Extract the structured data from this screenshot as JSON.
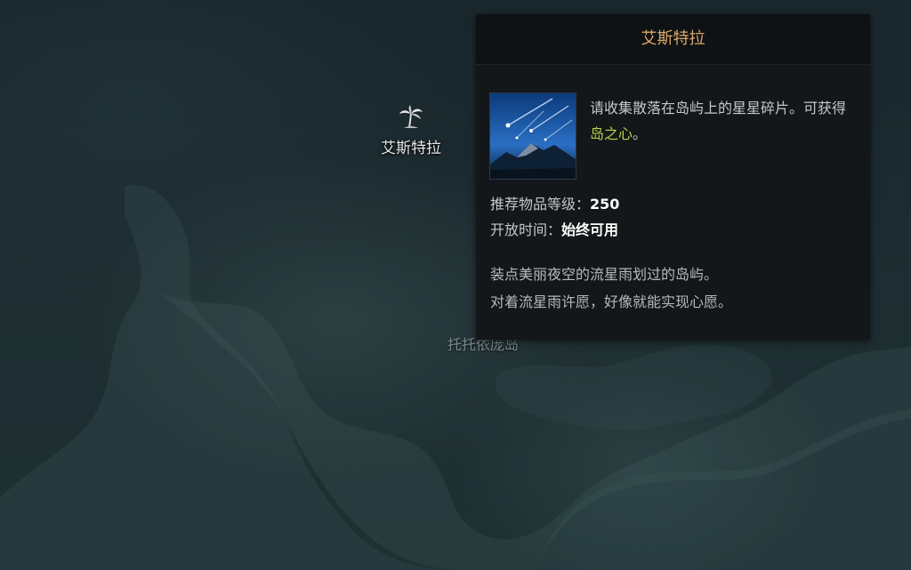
{
  "map": {
    "marker_label": "艾斯特拉",
    "marker_icon": "palm-tree-icon",
    "faded_label": "托托依庞岛"
  },
  "tooltip": {
    "title": "艾斯特拉",
    "item_icon": "meteor-shower-icon",
    "description_prefix": "请收集散落在岛屿上的星星碎片。可获得",
    "description_highlight": "岛之心",
    "description_suffix": "。",
    "recommended_label": "推荐物品等级：",
    "recommended_value": "250",
    "open_time_label": "开放时间：",
    "open_time_value": "始终可用",
    "flavor_line1": "装点美丽夜空的流星雨划过的岛屿。",
    "flavor_line2": "对着流星雨许愿，好像就能实现心愿。"
  },
  "colors": {
    "title": "#d9a86a",
    "highlight": "#b6d34a",
    "tooltip_bg": "#131719"
  }
}
